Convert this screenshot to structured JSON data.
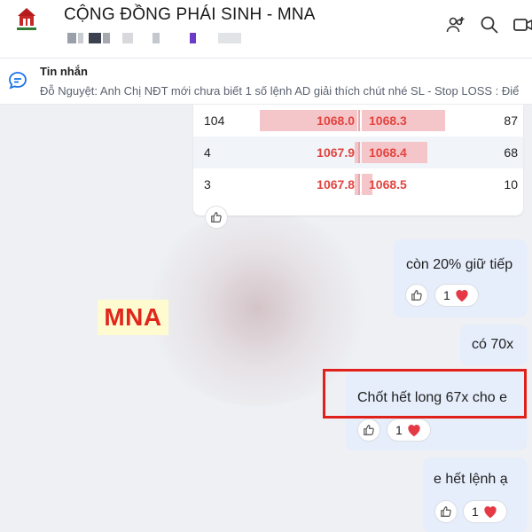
{
  "header": {
    "title": "CỘNG ĐỒNG PHÁI SINH - MNA",
    "logo_icon": "group-logo-icon",
    "icons": [
      "add-member-icon",
      "search-icon",
      "video-call-icon"
    ]
  },
  "pinned": {
    "title": "Tin nhắn",
    "text": "Đỗ Nguyệt: Anh Chị NĐT mới chưa biết 1 số lệnh AD giải thích chút nhé SL - Stop LOSS : Điể",
    "icon": "chat-bubble-icon"
  },
  "order_book": {
    "rows": [
      {
        "vol_bid": "104",
        "bid": "1068.0",
        "ask": "1068.3",
        "vol_ask": "87",
        "bid_fill": 0.58,
        "ask_fill": 0.5
      },
      {
        "vol_bid": "4",
        "bid": "1067.9",
        "ask": "1068.4",
        "vol_ask": "68",
        "bid_fill": 0.02,
        "ask_fill": 0.39
      },
      {
        "vol_bid": "3",
        "bid": "1067.8",
        "ask": "1068.5",
        "vol_ask": "10",
        "bid_fill": 0.02,
        "ask_fill": 0.06
      }
    ]
  },
  "watermark": "MNA",
  "messages": [
    {
      "text": "còn 20% giữ tiếp",
      "reaction_count": "1"
    },
    {
      "text": "có 70x"
    },
    {
      "text": "Chốt hết long 67x cho e",
      "reaction_count": "1"
    },
    {
      "text": "e hết lệnh ạ",
      "reaction_count": "1"
    }
  ],
  "colors": {
    "bubble": "#e6edfb",
    "price_red": "#e2443f",
    "highlight_border": "#e0201a",
    "watermark_text": "#e1261c",
    "watermark_bg": "#fffbd0"
  }
}
